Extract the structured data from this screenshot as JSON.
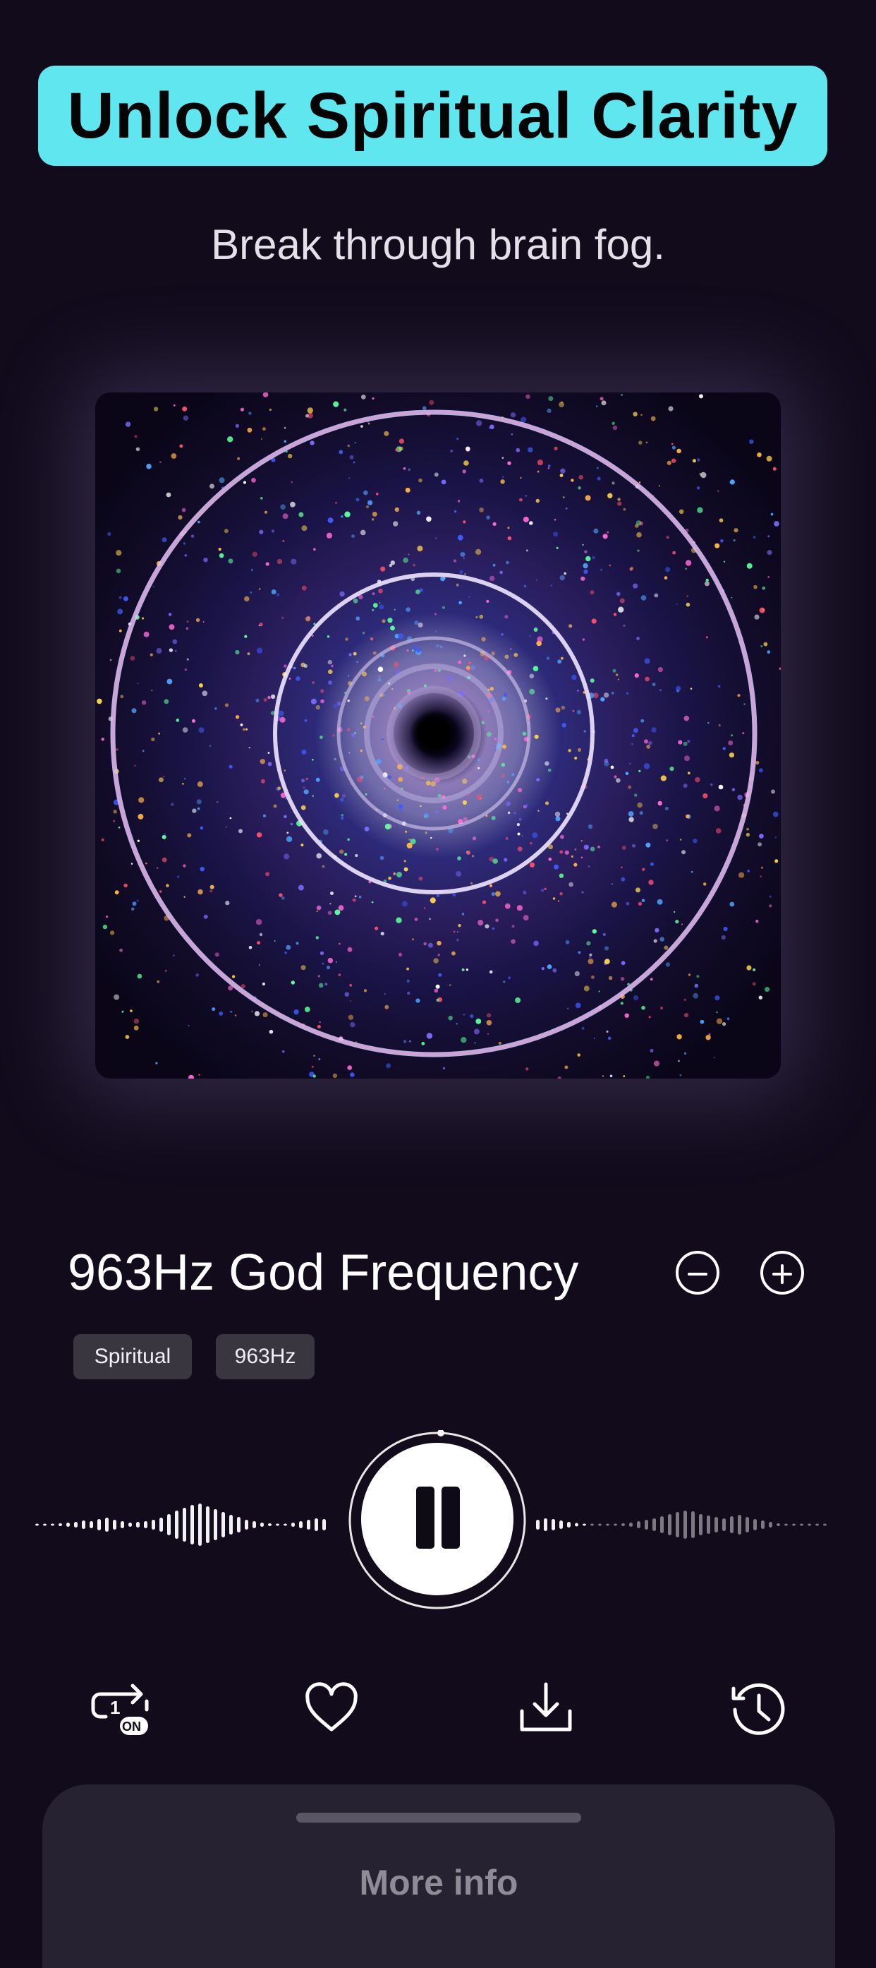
{
  "header": {
    "headline": "Unlock Spiritual Clarity",
    "subtitle": "Break through brain fog."
  },
  "player": {
    "track_title": "963Hz God Frequency",
    "tags": [
      "Spiritual",
      "963Hz"
    ],
    "state": "playing",
    "progress": 0.01
  },
  "controls": {
    "icons": [
      "repeat-one-on-icon",
      "heart-icon",
      "download-icon",
      "history-icon"
    ],
    "repeat_badge": "ON"
  },
  "sheet": {
    "label": "More info"
  },
  "colors": {
    "background": "#110b1c",
    "headline_bg": "#5fe6ef",
    "tag_bg": "#3a3640",
    "sheet_bg": "#262231"
  }
}
